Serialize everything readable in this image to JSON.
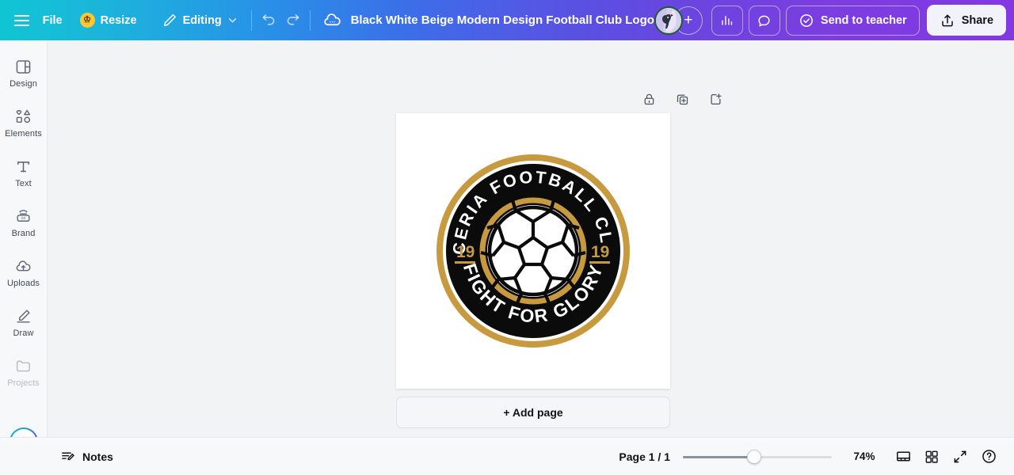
{
  "topbar": {
    "menu_icon": "hamburger-icon",
    "file_label": "File",
    "resize_label": "Resize",
    "resize_badge_icon": "crown-icon",
    "editing_label": "Editing",
    "editing_chevron_icon": "chevron-down-icon",
    "undo_icon": "undo-icon",
    "redo_icon": "redo-icon",
    "cloud_icon": "cloud-saved-icon",
    "doc_title": "Black White Beige Modern Design Football Club Logo",
    "avatar_icon": "user-avatar",
    "add_collaborator_label": "+",
    "analytics_icon": "bar-chart-icon",
    "comment_icon": "comment-bubble-icon",
    "send_to_teacher_label": "Send to teacher",
    "send_to_teacher_icon": "check-circle-icon",
    "share_label": "Share",
    "share_icon": "share-upload-icon",
    "gradient_start": "#10c4d4",
    "gradient_end": "#8338e2"
  },
  "sidebar": {
    "items": [
      {
        "label": "Design",
        "icon": "layout-panel-icon",
        "dim": false
      },
      {
        "label": "Elements",
        "icon": "shapes-icon",
        "dim": false
      },
      {
        "label": "Text",
        "icon": "text-t-icon",
        "dim": false
      },
      {
        "label": "Brand",
        "icon": "brand-kit-icon",
        "dim": false
      },
      {
        "label": "Uploads",
        "icon": "cloud-upload-icon",
        "dim": false
      },
      {
        "label": "Draw",
        "icon": "pen-draw-icon",
        "dim": false
      },
      {
        "label": "Projects",
        "icon": "folder-icon",
        "dim": true
      }
    ],
    "magic_button_icon": "magic-sparkle-icon"
  },
  "canvas": {
    "tools": [
      {
        "icon": "lock-icon",
        "name": "lock-page-button"
      },
      {
        "icon": "duplicate-page-icon",
        "name": "duplicate-page-button"
      },
      {
        "icon": "add-page-icon",
        "name": "add-page-after-button"
      }
    ],
    "add_page_label": "+ Add page",
    "page_background": "#ffffff",
    "workspace_background": "#f2f3f5"
  },
  "logo": {
    "arc_top_text": "LICERIA FOOTBALL CLUB",
    "arc_bottom_text": "FIGHT FOR GLORY",
    "year_left": "19",
    "year_right": "19",
    "ball_icon": "soccer-ball-icon",
    "colors": {
      "gold": "#c79a3f",
      "black": "#0b0b0b",
      "white": "#ffffff"
    }
  },
  "bottombar": {
    "notes_label": "Notes",
    "notes_icon": "notes-pencil-icon",
    "page_indicator": "Page 1 / 1",
    "zoom_value": "74%",
    "zoom_slider_percent": 48,
    "timeline_icon": "timeline-view-icon",
    "grid_icon": "grid-view-icon",
    "fullscreen_icon": "fullscreen-icon",
    "help_icon": "help-question-icon"
  }
}
